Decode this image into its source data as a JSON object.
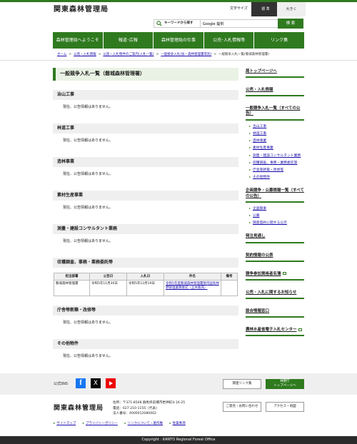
{
  "header": {
    "logo": "関東森林管理局",
    "font_size_label": "文字サイズ",
    "font_size_standard": "標 準",
    "font_size_large": "大きく"
  },
  "search": {
    "label": "キーワードから探す",
    "value": "Google 提供",
    "button": "検 索"
  },
  "gnav": [
    "森林管理局へようこそ",
    "報道･広報",
    "森林管理局の仕事",
    "公売･入札情報等",
    "リンク集"
  ],
  "breadcrumb": {
    "home": "ホーム",
    "b1": "公売・入札情報",
    "b2": "公売・入札物件のご案内(入札一覧)",
    "b3": "一般競争入札(局・森林管理署等別)",
    "current": "一般競争入札一覧(磐城森林管理署)",
    "sep": ">"
  },
  "main": {
    "title": "一般競争入札一覧（磐城森林管理署）",
    "none_text": "現在、公告情報はありません。",
    "sections": [
      "治山工事",
      "林道工事",
      "造林事業",
      "素材生産事業",
      "測量・建設コンサルタント業務",
      "収穫調査、事務・業務委託等",
      "庁舎等新築・改修等",
      "その他物件"
    ],
    "table": {
      "headers": [
        "担当部署",
        "公告日",
        "入札日",
        "件名",
        "備考"
      ],
      "row": [
        "磐城森林管理署",
        "令和5年11月30日",
        "令和5年12月19日",
        "令和5年度磐城森林管理署管内国有林野管理業務委託（立木販売）",
        ""
      ]
    }
  },
  "side": {
    "h1": "局トップページへ",
    "h2": "公売・入札情報",
    "h3": "一般競争入札一覧（すべての公告）",
    "list1": [
      "治山工事",
      "林道工事",
      "造林事業",
      "素材生産事業",
      "測量・建設コンサルタント業務",
      "収穫調査、事務・業務委託等",
      "庁舎等新築・改修等",
      "その他物件"
    ],
    "h4": "企画競争・公募情報一覧（すべての公告）",
    "list2": [
      "企画競争",
      "公募",
      "随意契約に関する公示"
    ],
    "h5": "発注見通し",
    "h6": "契約情報の公表",
    "h7": "競争参加資格者名簿",
    "h8": "公売・入札に関するお知らせ",
    "h9": "談合情報窓口",
    "h10": "農林水産省電子入札センター"
  },
  "footer": {
    "sns_label": "公式SNS",
    "sns_fb": "f",
    "sns_x": "X",
    "links_btn": "関連リンク集",
    "top_btn_1": "林野庁",
    "top_btn_2": "トップページへ",
    "logo": "関東森林管理局",
    "addr1": "住所：〒371-8508 群馬県前橋市岩神町4-16-25",
    "addr2": "電話：027-210-1155（代表）",
    "addr3": "法人番号：4000012080002",
    "contact_btn": "ご意見・お問い合わせ",
    "access_btn": "アクセス・地図",
    "links": [
      "サイトマップ",
      "プライバシーポリシー",
      "リンクについて・著作権",
      "免責事項"
    ],
    "copyright": "Copyright : KANTO Regional Forest Office"
  },
  "colors": {
    "accent": "#2f7a1f",
    "section_bg": "#efefef",
    "title_bg": "#e9f2e4"
  }
}
